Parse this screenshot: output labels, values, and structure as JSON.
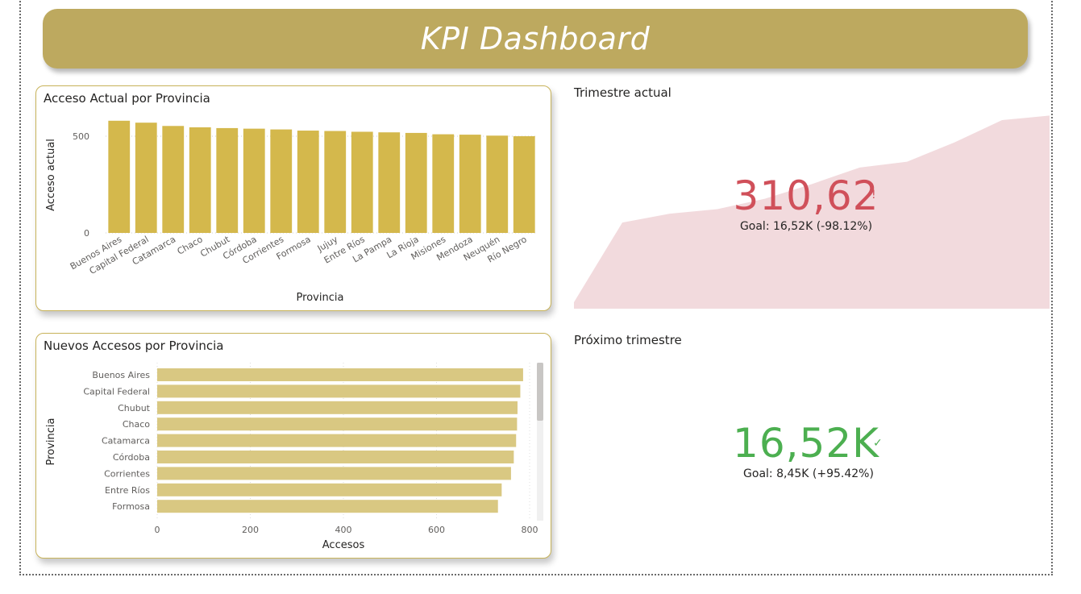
{
  "header": {
    "title": "KPI Dashboard"
  },
  "colors": {
    "banner": "#bda95f",
    "bar_vertical": "#d4b84c",
    "bar_horizontal": "#d9c882",
    "kpi_bad": "#d0505a",
    "kpi_good": "#4caf50",
    "trend_fill": "#f2dadd"
  },
  "kpi_current": {
    "title": "Trimestre actual",
    "value": "310,62",
    "indicator": "!",
    "goal": "Goal: 16,52K (-98.12%)",
    "trend": [
      290,
      320,
      335,
      370,
      420,
      475,
      495,
      560,
      635,
      650
    ]
  },
  "kpi_next": {
    "title": "Próximo trimestre",
    "value": "16,52K",
    "indicator": "✓",
    "goal": "Goal: 8,45K (+95.42%)"
  },
  "chart_data": [
    {
      "type": "bar",
      "title": "Acceso Actual por Provincia",
      "xlabel": "Provincia",
      "ylabel": "Acceso actual",
      "categories": [
        "Buenos Aires",
        "Capital Federal",
        "Catamarca",
        "Chaco",
        "Chubut",
        "Córdoba",
        "Corrientes",
        "Formosa",
        "Jujuy",
        "Entre Ríos",
        "La Pampa",
        "La Rioja",
        "Misiones",
        "Mendoza",
        "Neuquén",
        "Río Negro"
      ],
      "values": [
        580,
        570,
        553,
        546,
        542,
        539,
        535,
        529,
        527,
        523,
        520,
        517,
        510,
        508,
        503,
        500
      ],
      "yticks": [
        "0",
        "500"
      ],
      "ylim": [
        0,
        600
      ],
      "grid": true
    },
    {
      "type": "bar",
      "orientation": "horizontal",
      "title": "Nuevos Accesos por Provincia",
      "xlabel": "Accesos",
      "ylabel": "Provincia",
      "categories": [
        "Buenos Aires",
        "Capital Federal",
        "Chubut",
        "Chaco",
        "Catamarca",
        "Córdoba",
        "Corrientes",
        "Entre Ríos",
        "Formosa"
      ],
      "values": [
        786,
        780,
        774,
        773,
        771,
        766,
        760,
        740,
        732
      ],
      "xticks": [
        "0",
        "200",
        "400",
        "600",
        "800"
      ],
      "xlim": [
        0,
        800
      ],
      "grid": true
    }
  ]
}
